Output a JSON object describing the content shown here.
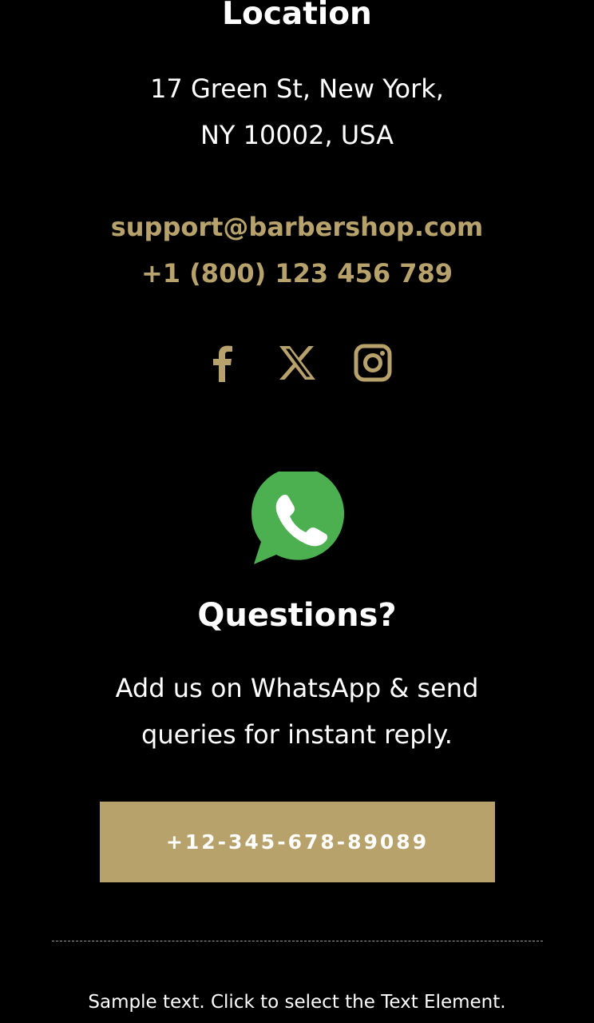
{
  "colors": {
    "background": "#000000",
    "text": "#ffffff",
    "accent": "#b8a26b",
    "whatsapp_green": "#4caf50",
    "divider": "#9a9a9a"
  },
  "location": {
    "title": "Location",
    "address_line1": "17 Green St, New York,",
    "address_line2": "NY 10002, USA"
  },
  "contact": {
    "email": "support@barbershop.com",
    "phone": "+1 (800) 123 456 789"
  },
  "social": {
    "icons": [
      "facebook-icon",
      "x-icon",
      "instagram-icon"
    ]
  },
  "whatsapp": {
    "icon": "whatsapp-icon",
    "title": "Questions?",
    "desc_line1": "Add us on WhatsApp & send",
    "desc_line2": "queries for instant reply.",
    "button_label": "+12-345-678-89089"
  },
  "footer": {
    "sample_text": "Sample text. Click to select the Text Element."
  }
}
